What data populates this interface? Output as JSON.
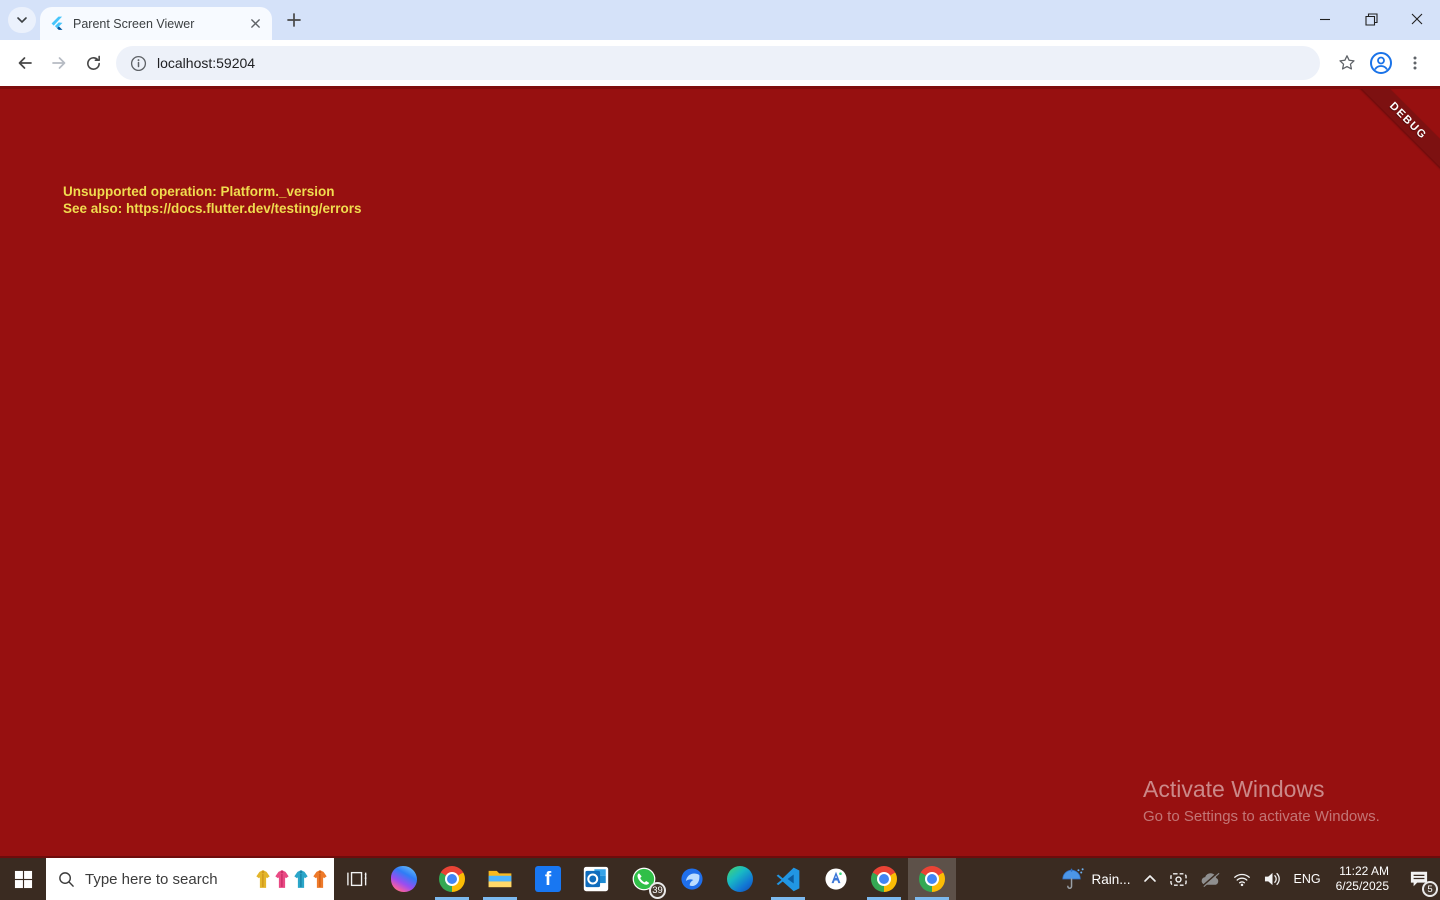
{
  "browser": {
    "tab": {
      "title": "Parent Screen Viewer",
      "favicon": "flutter-logo"
    },
    "url": "localhost:59204",
    "toolbar_icons": [
      "back-arrow",
      "forward-arrow",
      "reload",
      "site-info",
      "bookmark-star",
      "profile-avatar",
      "menu-dots"
    ],
    "window_control_icons": [
      "minimize",
      "maximize",
      "close"
    ]
  },
  "page": {
    "bg_color": "#971010",
    "error_text_color": "#F0DC4F",
    "error_lines": [
      "Unsupported operation: Platform._version",
      "See also: https://docs.flutter.dev/testing/errors"
    ],
    "debug_banner": "DEBUG",
    "activate_title": "Activate Windows",
    "activate_subtitle": "Go to Settings to activate Windows."
  },
  "taskbar": {
    "bg_color": "#3A2B21",
    "accent_underline_color": "#7CB9EE",
    "search_placeholder": "Type here to search",
    "search_highlight_icons": [
      "robe-yellow",
      "robe-pink",
      "robe-teal",
      "robe-orange"
    ],
    "apps": [
      "start",
      "task-view",
      "copilot",
      "chrome",
      "file-explorer",
      "facebook",
      "outlook",
      "whatsapp",
      "thunderbird",
      "edge",
      "vscode",
      "android-studio",
      "chrome",
      "chrome-active"
    ],
    "running_apps": [
      "chrome",
      "file-explorer",
      "vscode",
      "chrome",
      "chrome-active"
    ],
    "whatsapp_badge": "39",
    "tray": {
      "weather": "Rain...",
      "weather_icon": "umbrella-rain",
      "icons": [
        "chevron-up",
        "screen-cast",
        "cloud-offline",
        "wifi",
        "volume"
      ],
      "language": "ENG",
      "time": "11:22 AM",
      "date": "6/25/2025",
      "notification_count": "5"
    }
  }
}
